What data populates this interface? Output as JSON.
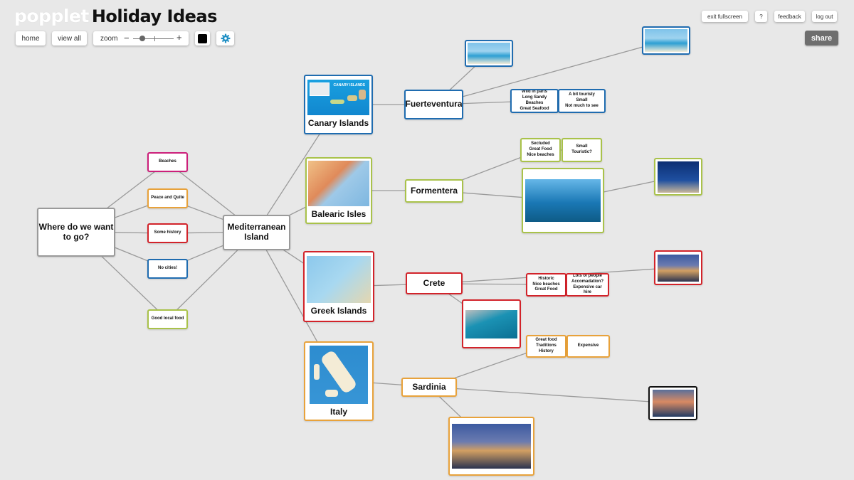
{
  "brand": {
    "logo": "popplet",
    "board_title": "Holiday Ideas"
  },
  "toolbar": {
    "home_label": "home",
    "view_all_label": "view all",
    "zoom_label": "zoom",
    "zoom_minus": "−",
    "zoom_plus": "+",
    "zoom_level": 0.22,
    "current_color": "#000000",
    "settings_icon": "gear-icon"
  },
  "top_right": {
    "exit_fullscreen_label": "exit fullscreen",
    "help_label": "?",
    "feedback_label": "feedback",
    "logout_label": "log out",
    "share_label": "share"
  },
  "colors": {
    "gray": "#9a9a9a",
    "pink": "#cc1f7a",
    "orange": "#e8a23b",
    "red": "#d2232a",
    "blue": "#1f6cb0",
    "green": "#a9c24a",
    "black": "#111111"
  },
  "popples": {
    "root": "Where do we want to go?",
    "mediterranean": "Mediterranean Island",
    "beaches": "Beaches",
    "peace": "Peace and Quite",
    "history": "Some history",
    "no_cities": "No cities!",
    "local_food": "Good local food",
    "canary": "Canary Islands",
    "canary_map_label": "CANARY ISLANDS",
    "balearic": "Balearic Isles",
    "greek": "Greek Islands",
    "italy": "Italy",
    "fuerteventura": "Fuerteventura",
    "fuert_pros": "Wild in parts\nLong Sandy Beaches\nGreat Seafood",
    "fuert_cons": "A bit touristy\nSmall\nNot much to see",
    "formentera": "Formentera",
    "form_pros": "Secluded\nGreat Food\nNice beaches",
    "form_cons": "Small\nTouristic?",
    "crete": "Crete",
    "crete_pros": "Historic\nNice beaches\nGreat Food",
    "crete_cons": "Lots of people\nAccomadation?\nExpensive car hire",
    "sardinia": "Sardinia",
    "sard_pros": "Great food\nTraditions\nHistory",
    "sard_cons": "Expensive"
  }
}
